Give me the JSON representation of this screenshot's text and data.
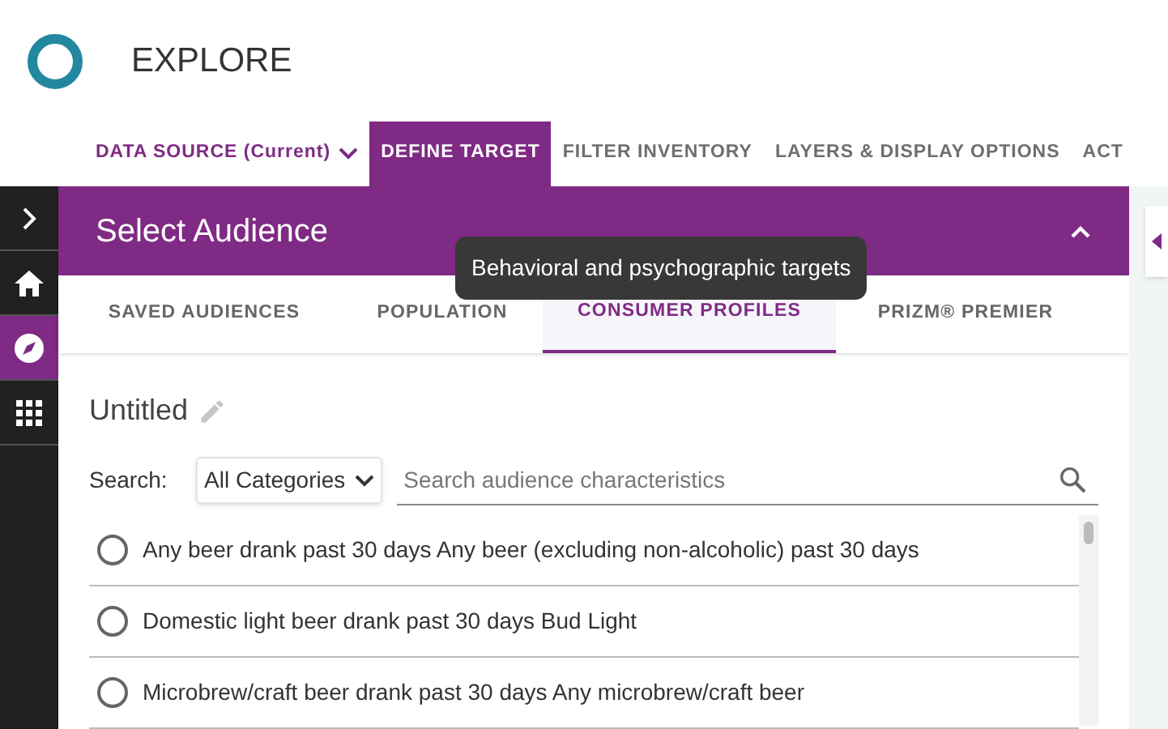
{
  "app": {
    "title": "EXPLORE"
  },
  "nav_tabs": [
    {
      "label": "DATA SOURCE (Current)",
      "selected": false,
      "kind": "dropdown"
    },
    {
      "label": "DEFINE TARGET",
      "selected": true,
      "kind": "tab"
    },
    {
      "label": "FILTER INVENTORY",
      "selected": false,
      "kind": "tab"
    },
    {
      "label": "LAYERS & DISPLAY OPTIONS",
      "selected": false,
      "kind": "tab"
    },
    {
      "label": "ACT",
      "selected": false,
      "kind": "tab"
    }
  ],
  "sidebar": {
    "items": [
      {
        "kind": "chevron",
        "selected": false
      },
      {
        "kind": "home",
        "selected": false
      },
      {
        "kind": "compass",
        "selected": true
      },
      {
        "kind": "grid",
        "selected": false
      }
    ]
  },
  "panel": {
    "title": "Select Audience",
    "tooltip": "Behavioral and psychographic targets",
    "tabs": [
      {
        "label": "SAVED AUDIENCES",
        "selected": false
      },
      {
        "label": "POPULATION",
        "selected": false
      },
      {
        "label": "CONSUMER PROFILES",
        "selected": true
      },
      {
        "label": "PRIZM® PREMIER",
        "selected": false
      }
    ],
    "audience_name": "Untitled",
    "search_label": "Search:",
    "category": "All Categories",
    "search": {
      "placeholder": "Search audience characteristics"
    },
    "options": [
      {
        "label": "Any beer drank past 30 days Any beer (excluding non-alcoholic) past 30 days",
        "selected": false
      },
      {
        "label": "Domestic light beer drank past 30 days Bud Light",
        "selected": false
      },
      {
        "label": "Microbrew/craft beer drank past 30 days Any microbrew/craft beer",
        "selected": false
      }
    ]
  }
}
